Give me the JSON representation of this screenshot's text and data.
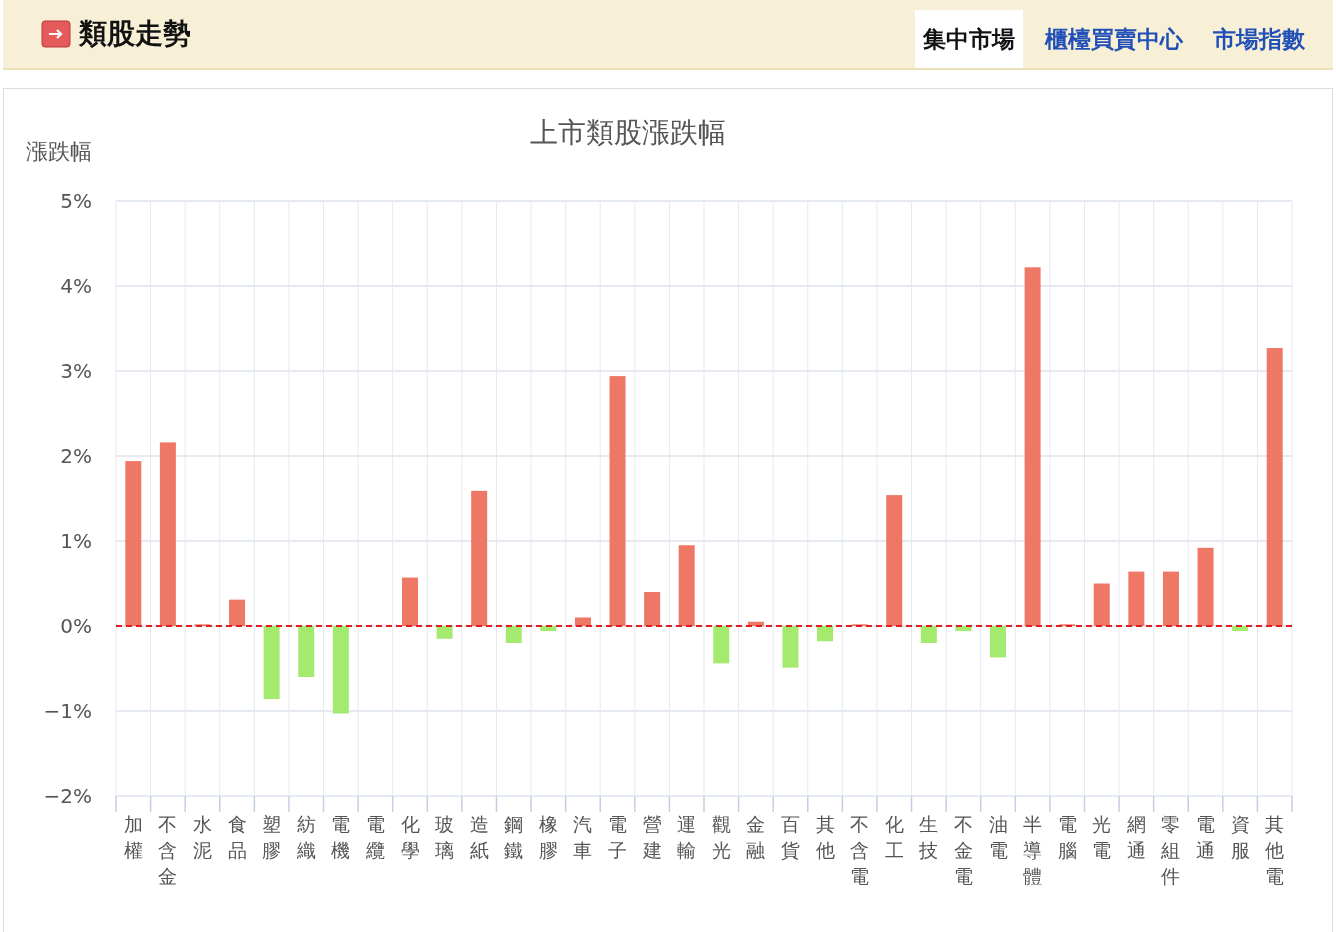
{
  "header": {
    "title": "類股走勢",
    "tabs": [
      {
        "label": "集中市場",
        "selected": true
      },
      {
        "label": "櫃檯買賣中心",
        "selected": false
      },
      {
        "label": "市場指數",
        "selected": false
      }
    ]
  },
  "chart": {
    "chart_data": {
      "type": "bar",
      "title": "上市類股漲跌幅",
      "ylabel": "漲跌幅",
      "categories": [
        "加權",
        "不含金",
        "水泥",
        "食品",
        "塑膠",
        "紡織",
        "電機",
        "電纜",
        "化學",
        "玻璃",
        "造紙",
        "鋼鐵",
        "橡膠",
        "汽車",
        "電子",
        "營建",
        "運輸",
        "觀光",
        "金融",
        "百貨",
        "其他",
        "不含電",
        "化工",
        "生技",
        "不金電",
        "油電",
        "半導體",
        "電腦",
        "光電",
        "網通",
        "零組件",
        "電通",
        "資服",
        "其他電"
      ],
      "series": [
        {
          "color": "#ee7766",
          "values": [
            1.94,
            2.16,
            0.02,
            0.31,
            null,
            null,
            null,
            0,
            0.57,
            null,
            1.59,
            null,
            null,
            0.1,
            2.94,
            0.4,
            0.95,
            null,
            0.05,
            null,
            null,
            0.02,
            1.54,
            null,
            null,
            null,
            4.22,
            0.02,
            0.5,
            0.64,
            0.64,
            0.92,
            null,
            3.27
          ]
        },
        {
          "color": "#a3ea6e",
          "values": [
            null,
            null,
            null,
            null,
            -0.86,
            -0.6,
            -1.03,
            null,
            null,
            -0.15,
            null,
            -0.2,
            -0.06,
            null,
            null,
            null,
            null,
            -0.44,
            null,
            -0.49,
            -0.18,
            null,
            null,
            -0.2,
            -0.06,
            -0.37,
            null,
            null,
            null,
            null,
            null,
            null,
            -0.06,
            null
          ]
        }
      ],
      "stacked": true,
      "grid": true,
      "ylim": [
        -2,
        5
      ],
      "yticks": [
        {
          "value": -2,
          "label": "−2%"
        },
        {
          "value": -1,
          "label": "−1%"
        },
        {
          "value": 0,
          "label": "0%"
        },
        {
          "value": 1,
          "label": "1%"
        },
        {
          "value": 2,
          "label": "2%"
        },
        {
          "value": 3,
          "label": "3%"
        },
        {
          "value": 4,
          "label": "4%"
        },
        {
          "value": 5,
          "label": "5%"
        }
      ],
      "ref_lines": [
        {
          "axis": "y",
          "value": 0,
          "color": "#e02020"
        }
      ]
    }
  }
}
